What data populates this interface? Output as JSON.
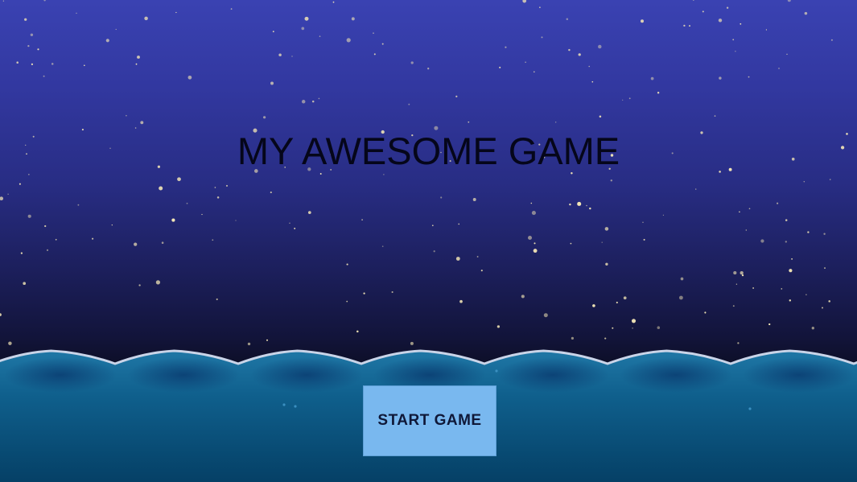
{
  "game": {
    "title": "MY AWESOME GAME",
    "start_button_label": "START GAME"
  },
  "colors": {
    "sky_top": "#3a42b2",
    "sky_bottom": "#0a0b1a",
    "sea_top": "#1c6e9c",
    "sea_bottom": "#06496e",
    "wave_crest": "#c7d2e6",
    "button_bg": "#79b8ef",
    "button_text": "#0f1838",
    "title_text": "#05061a"
  }
}
